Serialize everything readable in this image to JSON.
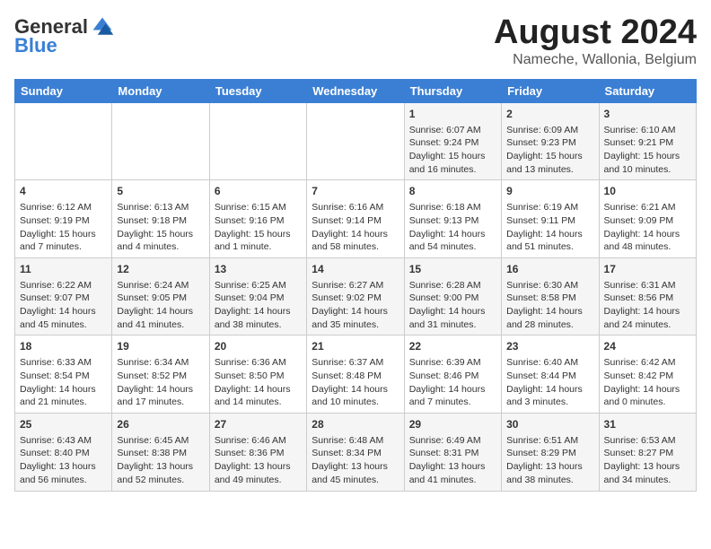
{
  "header": {
    "logo_general": "General",
    "logo_blue": "Blue",
    "month_title": "August 2024",
    "location": "Nameche, Wallonia, Belgium"
  },
  "weekdays": [
    "Sunday",
    "Monday",
    "Tuesday",
    "Wednesday",
    "Thursday",
    "Friday",
    "Saturday"
  ],
  "weeks": [
    [
      {
        "day": "",
        "info": ""
      },
      {
        "day": "",
        "info": ""
      },
      {
        "day": "",
        "info": ""
      },
      {
        "day": "",
        "info": ""
      },
      {
        "day": "1",
        "info": "Sunrise: 6:07 AM\nSunset: 9:24 PM\nDaylight: 15 hours and 16 minutes."
      },
      {
        "day": "2",
        "info": "Sunrise: 6:09 AM\nSunset: 9:23 PM\nDaylight: 15 hours and 13 minutes."
      },
      {
        "day": "3",
        "info": "Sunrise: 6:10 AM\nSunset: 9:21 PM\nDaylight: 15 hours and 10 minutes."
      }
    ],
    [
      {
        "day": "4",
        "info": "Sunrise: 6:12 AM\nSunset: 9:19 PM\nDaylight: 15 hours and 7 minutes."
      },
      {
        "day": "5",
        "info": "Sunrise: 6:13 AM\nSunset: 9:18 PM\nDaylight: 15 hours and 4 minutes."
      },
      {
        "day": "6",
        "info": "Sunrise: 6:15 AM\nSunset: 9:16 PM\nDaylight: 15 hours and 1 minute."
      },
      {
        "day": "7",
        "info": "Sunrise: 6:16 AM\nSunset: 9:14 PM\nDaylight: 14 hours and 58 minutes."
      },
      {
        "day": "8",
        "info": "Sunrise: 6:18 AM\nSunset: 9:13 PM\nDaylight: 14 hours and 54 minutes."
      },
      {
        "day": "9",
        "info": "Sunrise: 6:19 AM\nSunset: 9:11 PM\nDaylight: 14 hours and 51 minutes."
      },
      {
        "day": "10",
        "info": "Sunrise: 6:21 AM\nSunset: 9:09 PM\nDaylight: 14 hours and 48 minutes."
      }
    ],
    [
      {
        "day": "11",
        "info": "Sunrise: 6:22 AM\nSunset: 9:07 PM\nDaylight: 14 hours and 45 minutes."
      },
      {
        "day": "12",
        "info": "Sunrise: 6:24 AM\nSunset: 9:05 PM\nDaylight: 14 hours and 41 minutes."
      },
      {
        "day": "13",
        "info": "Sunrise: 6:25 AM\nSunset: 9:04 PM\nDaylight: 14 hours and 38 minutes."
      },
      {
        "day": "14",
        "info": "Sunrise: 6:27 AM\nSunset: 9:02 PM\nDaylight: 14 hours and 35 minutes."
      },
      {
        "day": "15",
        "info": "Sunrise: 6:28 AM\nSunset: 9:00 PM\nDaylight: 14 hours and 31 minutes."
      },
      {
        "day": "16",
        "info": "Sunrise: 6:30 AM\nSunset: 8:58 PM\nDaylight: 14 hours and 28 minutes."
      },
      {
        "day": "17",
        "info": "Sunrise: 6:31 AM\nSunset: 8:56 PM\nDaylight: 14 hours and 24 minutes."
      }
    ],
    [
      {
        "day": "18",
        "info": "Sunrise: 6:33 AM\nSunset: 8:54 PM\nDaylight: 14 hours and 21 minutes."
      },
      {
        "day": "19",
        "info": "Sunrise: 6:34 AM\nSunset: 8:52 PM\nDaylight: 14 hours and 17 minutes."
      },
      {
        "day": "20",
        "info": "Sunrise: 6:36 AM\nSunset: 8:50 PM\nDaylight: 14 hours and 14 minutes."
      },
      {
        "day": "21",
        "info": "Sunrise: 6:37 AM\nSunset: 8:48 PM\nDaylight: 14 hours and 10 minutes."
      },
      {
        "day": "22",
        "info": "Sunrise: 6:39 AM\nSunset: 8:46 PM\nDaylight: 14 hours and 7 minutes."
      },
      {
        "day": "23",
        "info": "Sunrise: 6:40 AM\nSunset: 8:44 PM\nDaylight: 14 hours and 3 minutes."
      },
      {
        "day": "24",
        "info": "Sunrise: 6:42 AM\nSunset: 8:42 PM\nDaylight: 14 hours and 0 minutes."
      }
    ],
    [
      {
        "day": "25",
        "info": "Sunrise: 6:43 AM\nSunset: 8:40 PM\nDaylight: 13 hours and 56 minutes."
      },
      {
        "day": "26",
        "info": "Sunrise: 6:45 AM\nSunset: 8:38 PM\nDaylight: 13 hours and 52 minutes."
      },
      {
        "day": "27",
        "info": "Sunrise: 6:46 AM\nSunset: 8:36 PM\nDaylight: 13 hours and 49 minutes."
      },
      {
        "day": "28",
        "info": "Sunrise: 6:48 AM\nSunset: 8:34 PM\nDaylight: 13 hours and 45 minutes."
      },
      {
        "day": "29",
        "info": "Sunrise: 6:49 AM\nSunset: 8:31 PM\nDaylight: 13 hours and 41 minutes."
      },
      {
        "day": "30",
        "info": "Sunrise: 6:51 AM\nSunset: 8:29 PM\nDaylight: 13 hours and 38 minutes."
      },
      {
        "day": "31",
        "info": "Sunrise: 6:53 AM\nSunset: 8:27 PM\nDaylight: 13 hours and 34 minutes."
      }
    ]
  ]
}
